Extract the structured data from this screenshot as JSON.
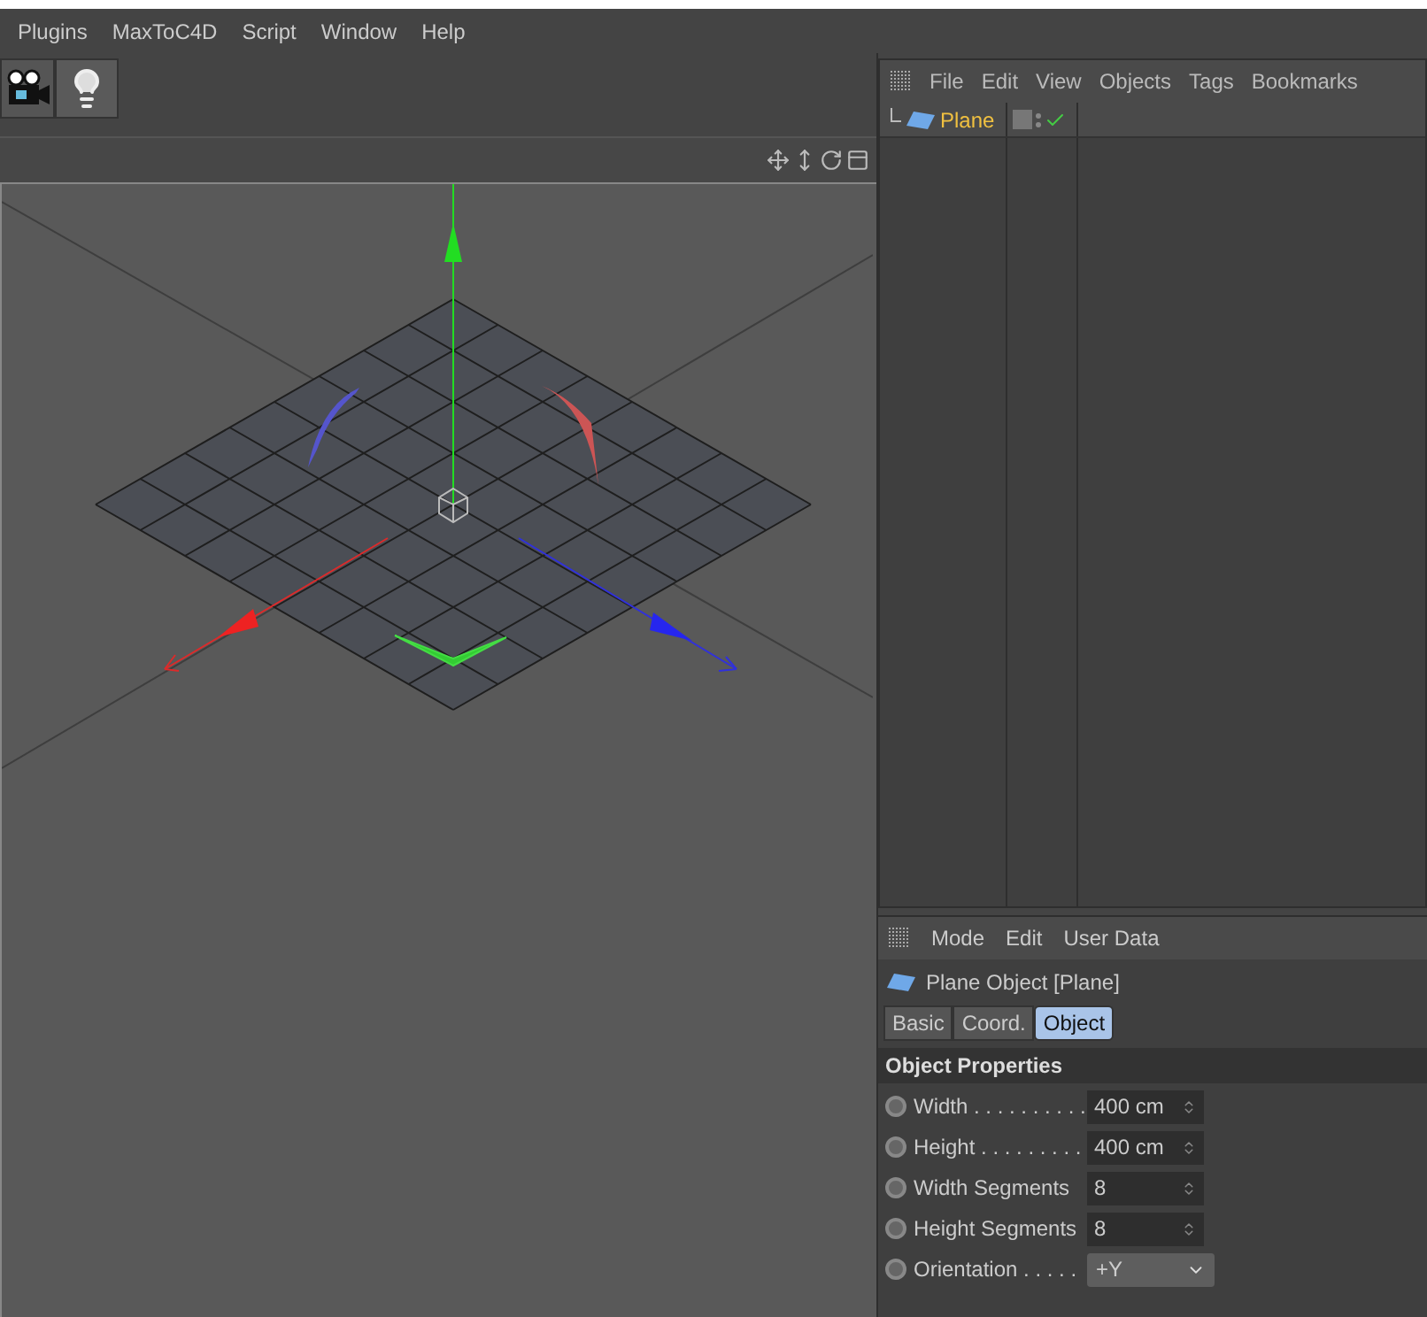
{
  "menu_bar": [
    "Plugins",
    "MaxToC4D",
    "Script",
    "Window",
    "Help"
  ],
  "object_manager": {
    "menu": [
      "File",
      "Edit",
      "View",
      "Objects",
      "Tags",
      "Bookmarks"
    ],
    "objects": [
      {
        "name": "Plane",
        "selected": true,
        "checked": true
      }
    ]
  },
  "attribute_manager": {
    "menu": [
      "Mode",
      "Edit",
      "User Data"
    ],
    "title": "Plane Object [Plane]",
    "tabs": [
      {
        "label": "Basic",
        "selected": false
      },
      {
        "label": "Coord.",
        "selected": false
      },
      {
        "label": "Object",
        "selected": true
      }
    ],
    "section": "Object Properties",
    "properties": [
      {
        "label": "Width . . . . . . . . . .",
        "kind": "number",
        "value": "400 cm"
      },
      {
        "label": "Height . . . . . . . . .",
        "kind": "number",
        "value": "400 cm"
      },
      {
        "label": "Width Segments",
        "kind": "number",
        "value": "8"
      },
      {
        "label": "Height Segments",
        "kind": "number",
        "value": "8"
      },
      {
        "label": "Orientation . . . . .",
        "kind": "dropdown",
        "value": "+Y"
      }
    ]
  }
}
